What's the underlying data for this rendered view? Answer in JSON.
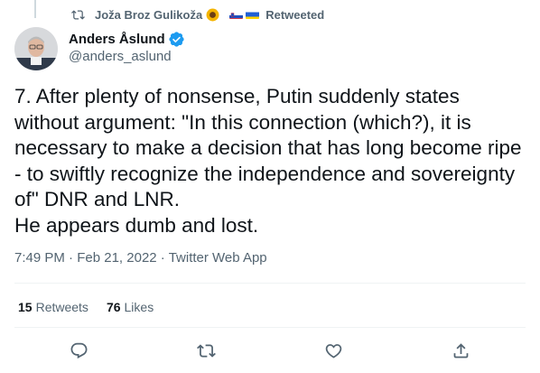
{
  "retweet": {
    "retweeter_name": "Joža Broz Gulikoža",
    "label": "Retweeted",
    "icon": "retweet-icon",
    "emoji_badges": [
      "sunflower",
      "flag-slovenia",
      "flag-ukraine"
    ]
  },
  "author": {
    "display_name": "Anders Åslund",
    "handle": "@anders_aslund",
    "verified": true
  },
  "tweet": {
    "text": "7. After plenty of nonsense, Putin suddenly states without argument: \"In this connection (which?), it is necessary to make a decision that has long become ripe - to swiftly recognize the independence and sovereignty of\" DNR and LNR.\nHe appears dumb and lost.",
    "time": "7:49 PM",
    "date": "Feb 21, 2022",
    "source": "Twitter Web App",
    "separator": "·"
  },
  "stats": {
    "retweets_count": "15",
    "retweets_label": "Retweets",
    "likes_count": "76",
    "likes_label": "Likes"
  },
  "actions": [
    "reply-icon",
    "retweet-icon",
    "like-icon",
    "share-icon"
  ],
  "colors": {
    "text": "#0f1419",
    "secondary": "#536471",
    "verified": "#1d9bf0",
    "divider": "#eff3f4"
  }
}
